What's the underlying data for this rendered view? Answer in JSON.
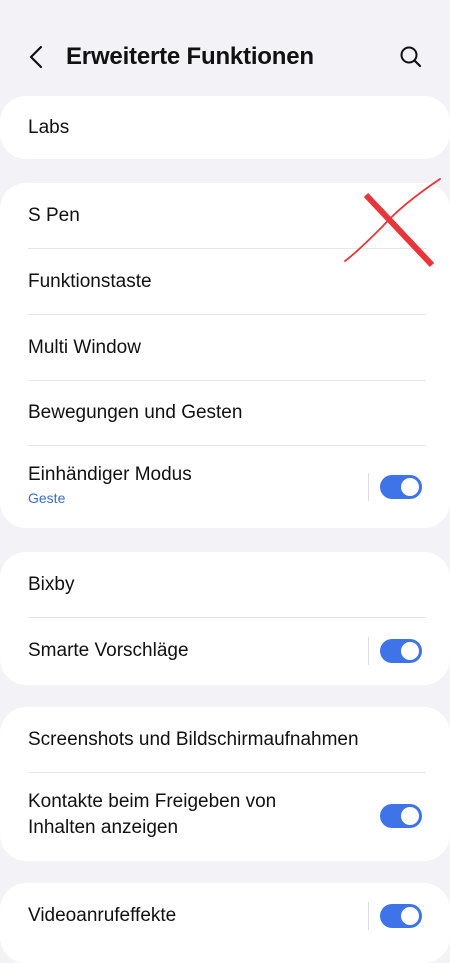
{
  "header": {
    "title": "Erweiterte Funktionen",
    "back_icon": "chevron-left-icon",
    "search_icon": "search-icon"
  },
  "cards": [
    {
      "rows": [
        {
          "label": "Labs"
        }
      ]
    },
    {
      "rows": [
        {
          "label": "S Pen"
        },
        {
          "label": "Funktionstaste"
        },
        {
          "label": "Multi Window"
        },
        {
          "label": "Bewegungen und Gesten"
        },
        {
          "label": "Einhändiger Modus",
          "sublabel": "Geste",
          "toggle": true
        }
      ]
    },
    {
      "rows": [
        {
          "label": "Bixby"
        },
        {
          "label": "Smarte Vorschläge",
          "toggle": true
        }
      ]
    },
    {
      "rows": [
        {
          "label": "Screenshots und Bildschirmaufnahmen"
        },
        {
          "label_line1": "Kontakte beim Freigeben von",
          "label_line2": "Inhalten anzeigen",
          "toggle": true
        }
      ]
    },
    {
      "rows": [
        {
          "label": "Videoanrufeffekte",
          "toggle": true
        }
      ]
    }
  ],
  "colors": {
    "background": "#f2f2f7",
    "card": "#ffffff",
    "accent_toggle": "#3e74e8",
    "sublabel": "#3a6cc9",
    "annotation_red": "#e8353a"
  }
}
